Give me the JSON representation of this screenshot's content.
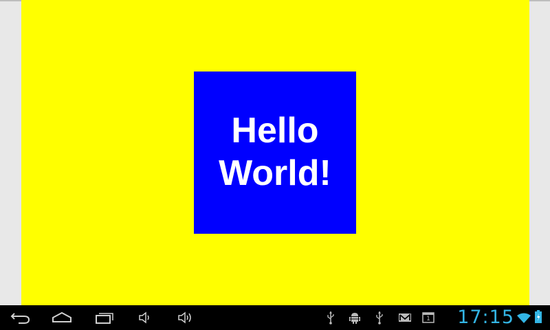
{
  "app": {
    "greeting": "Hello World!",
    "background_color": "#ffff00",
    "box_color": "#0000ff",
    "text_color": "#ffffff"
  },
  "navbar": {
    "buttons": [
      "back-icon",
      "home-icon",
      "recent-apps-icon",
      "volume-down-icon",
      "volume-up-icon"
    ]
  },
  "status": {
    "notifications": [
      "usb-icon",
      "android-debug-icon",
      "usb-icon",
      "gmail-icon",
      "notification-count-icon"
    ],
    "notification_count": "1",
    "time": "17:15",
    "clock_color": "#33b5e5",
    "system_icons": [
      "wifi-icon",
      "battery-icon"
    ]
  }
}
